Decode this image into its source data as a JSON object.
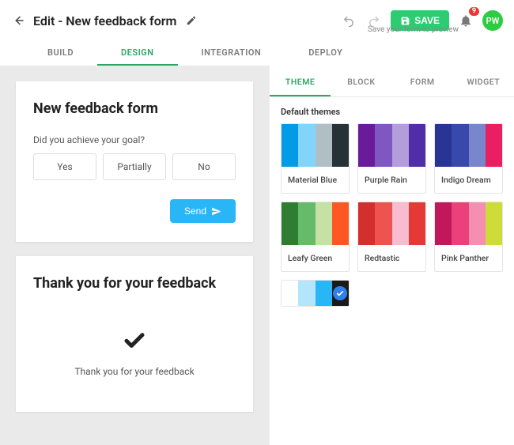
{
  "header": {
    "title": "Edit - New feedback form",
    "save_label": "SAVE",
    "save_hint": "Save your form to preview",
    "notification_count": "9",
    "avatar_initials": "PW"
  },
  "main_tabs": [
    "BUILD",
    "DESIGN",
    "INTEGRATION",
    "DEPLOY"
  ],
  "main_tab_active": 1,
  "sub_tabs": [
    "THEME",
    "BLOCK",
    "FORM",
    "WIDGET"
  ],
  "sub_tab_active": 0,
  "themes": {
    "section_label": "Default themes",
    "items": [
      {
        "name": "Material Blue",
        "colors": [
          "#039be5",
          "#81d4fa",
          "#b0bec5",
          "#263238"
        ]
      },
      {
        "name": "Purple Rain",
        "colors": [
          "#6a1b9a",
          "#7e57c2",
          "#b39ddb",
          "#512da8"
        ]
      },
      {
        "name": "Indigo Dream",
        "colors": [
          "#283593",
          "#3949ab",
          "#7986cb",
          "#e91e63"
        ]
      },
      {
        "name": "Leafy Green",
        "colors": [
          "#2e7d32",
          "#66bb6a",
          "#c5e1a5",
          "#ff5722"
        ]
      },
      {
        "name": "Redtastic",
        "colors": [
          "#d32f2f",
          "#ef5350",
          "#f8bbd0",
          "#e53935"
        ]
      },
      {
        "name": "Pink Panther",
        "colors": [
          "#c2185b",
          "#ec407a",
          "#f48fb1",
          "#cddc39"
        ]
      }
    ],
    "selected_custom": {
      "colors": [
        "#ffffff",
        "#b3e5fc",
        "#29b6f6",
        "#1a1a1a"
      ]
    }
  },
  "preview": {
    "form_title": "New feedback form",
    "question": "Did you achieve your goal?",
    "choices": [
      "Yes",
      "Partially",
      "No"
    ],
    "send_label": "Send",
    "thankyou_title": "Thank you for your feedback",
    "thankyou_message": "Thank you for your feedback"
  }
}
